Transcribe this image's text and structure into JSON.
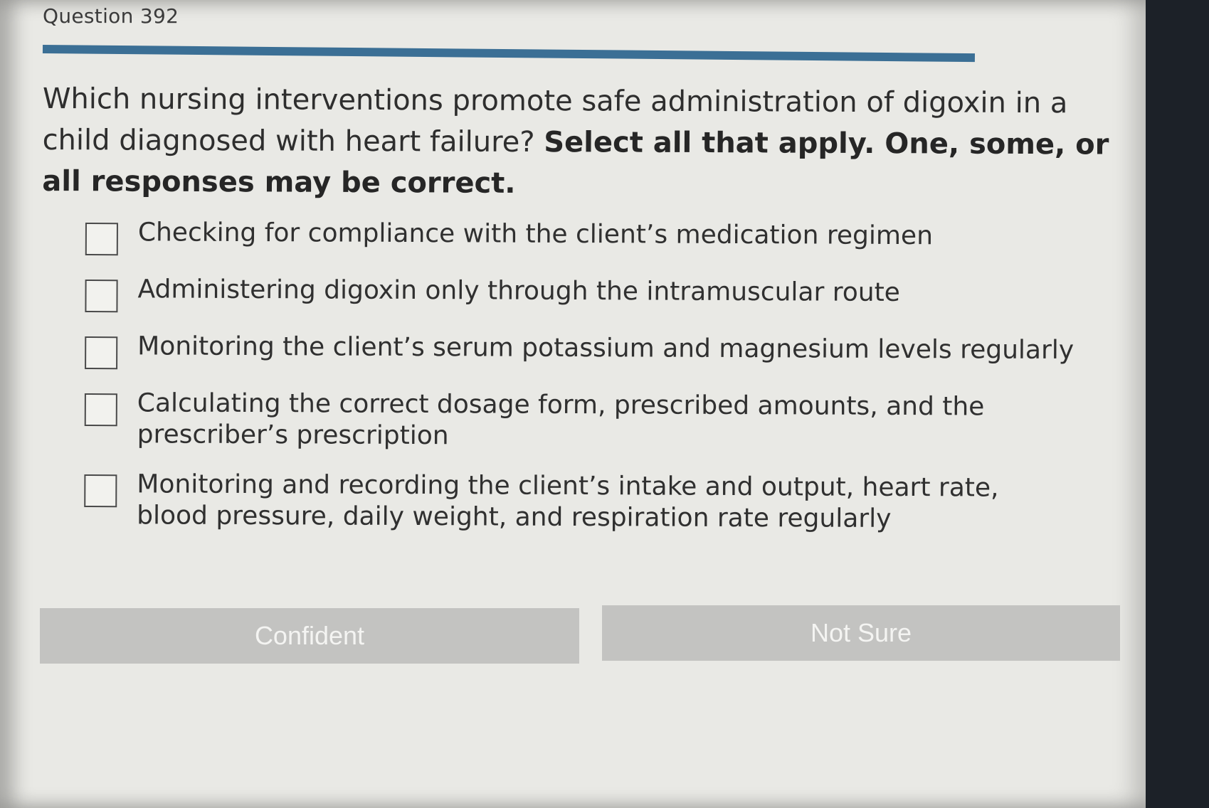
{
  "header": {
    "question_number": "Question 392"
  },
  "progress": {
    "value": 0.92,
    "color": "#3b6f95"
  },
  "question": {
    "stem_regular": "Which nursing interventions promote safe administration of digoxin in a child diagnosed with heart failure? ",
    "stem_bold": "Select all that apply. One, some, or all responses may be correct."
  },
  "options": [
    {
      "label": "Checking for compliance with the client’s medication regimen",
      "checked": false
    },
    {
      "label": "Administering digoxin only through the intramuscular route",
      "checked": false
    },
    {
      "label": "Monitoring the client’s serum potassium and magnesium levels regularly",
      "checked": false
    },
    {
      "label": "Calculating the correct dosage form, prescribed amounts, and the prescriber’s prescription",
      "checked": false
    },
    {
      "label": "Monitoring and recording the client’s intake and output, heart rate, blood pressure, daily weight, and respiration rate regularly",
      "checked": false
    }
  ],
  "buttons": {
    "confident": "Confident",
    "not_sure": "Not Sure"
  }
}
